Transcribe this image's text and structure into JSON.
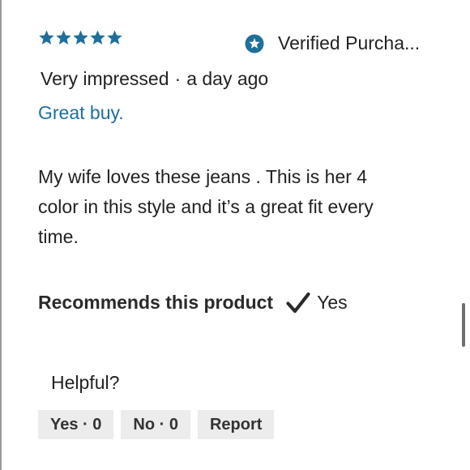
{
  "review": {
    "rating": 5,
    "rating_max": 5,
    "star_color": "#1f6f9a",
    "verified_label": "Verified Purcha...",
    "verified_icon": "verified-star-badge",
    "author": "Very impressed",
    "separator": "·",
    "time": "a day ago",
    "title": "Great buy.",
    "body": "My wife loves these jeans . This is her 4 color in this style and it’s a great fit every time.",
    "recommend_label": "Recommends this product",
    "recommend_icon": "checkmark",
    "recommend_value": "Yes"
  },
  "feedback": {
    "helpful_label": "Helpful?",
    "yes_label": "Yes · 0",
    "no_label": "No · 0",
    "report_label": "Report"
  },
  "colors": {
    "accent": "#1f6f9a",
    "text": "#222222",
    "button_bg": "#ececec"
  }
}
